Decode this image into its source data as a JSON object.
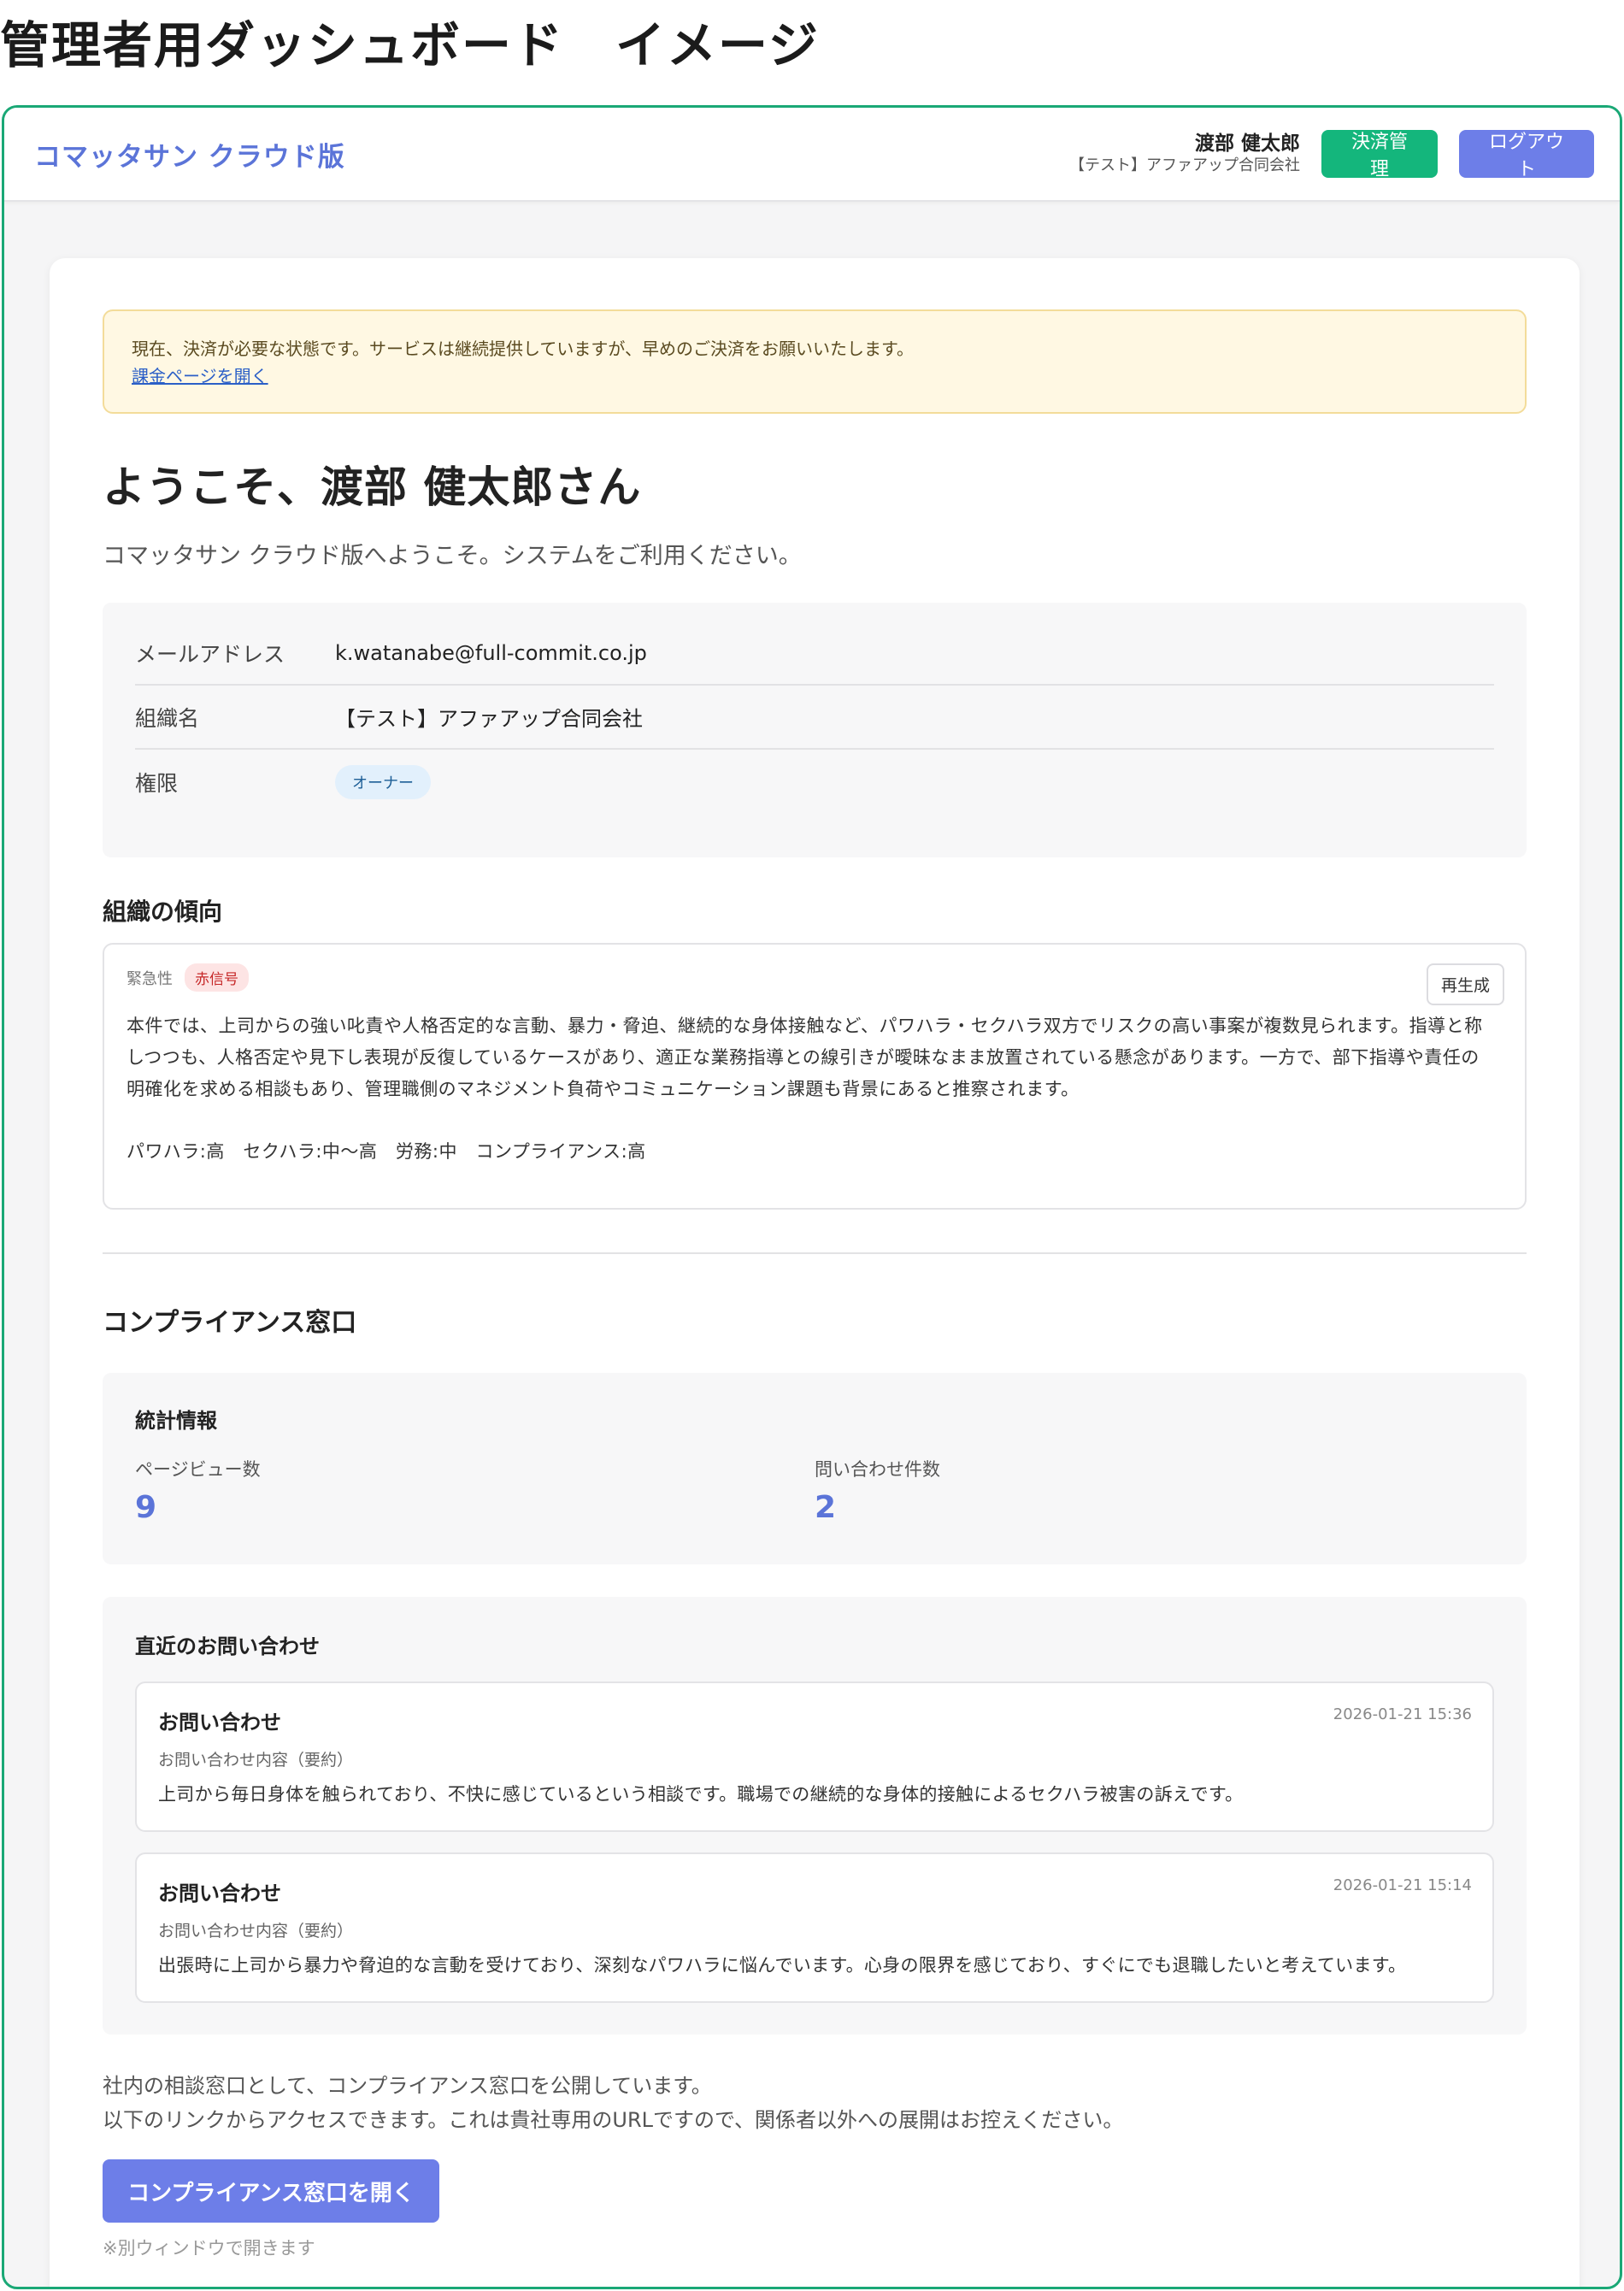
{
  "page": {
    "caption": "管理者用ダッシュボード　イメージ"
  },
  "header": {
    "brand": "コマッタサン クラウド版",
    "user_name": "渡部 健太郎",
    "user_org": "【テスト】アファアップ合同会社",
    "billing_button": "決済管理",
    "logout_button": "ログアウト"
  },
  "notice": {
    "message": "現在、決済が必要な状態です。サービスは継続提供していますが、早めのご決済をお願いいたします。",
    "link": "課金ページを開く"
  },
  "welcome": {
    "title": "ようこそ、渡部 健太郎さん",
    "subtitle": "コマッタサン クラウド版へようこそ。システムをご利用ください。"
  },
  "info": {
    "email_label": "メールアドレス",
    "email_value": "k.watanabe@full-commit.co.jp",
    "org_label": "組織名",
    "org_value": "【テスト】アファアップ合同会社",
    "role_label": "権限",
    "role_value": "オーナー"
  },
  "trend": {
    "title": "組織の傾向",
    "urgency_label": "緊急性",
    "urgency_value": "赤信号",
    "regenerate": "再生成",
    "text_line1": "本件では、上司からの強い叱責や人格否定的な言動、暴力・脅迫、継続的な身体接触など、パワハラ・セクハラ双方でリスクの高い事案が複数見られます。指導と称",
    "text_line2": "しつつも、人格否定や見下し表現が反復しているケースがあり、適正な業務指導との線引きが曖昧なまま放置されている懸念があります。一方で、部下指導や責任の",
    "text_line3": "明確化を求める相談もあり、管理職側のマネジメント負荷やコミュニケーション課題も背景にあると推察されます。",
    "scores": "パワハラ:高　セクハラ:中〜高　労務:中　コンプライアンス:高"
  },
  "compliance": {
    "title": "コンプライアンス窓口",
    "stats_heading": "統計情報",
    "pageviews_label": "ページビュー数",
    "pageviews_value": "9",
    "inquiries_label": "問い合わせ件数",
    "inquiries_value": "2",
    "recent_heading": "直近のお問い合わせ",
    "inquiries": [
      {
        "title": "お問い合わせ",
        "date": "2026-01-21 15:36",
        "summary_label": "お問い合わせ内容（要約）",
        "summary": "上司から毎日身体を触られており、不快に感じているという相談です。職場での継続的な身体的接触によるセクハラ被害の訴えです。"
      },
      {
        "title": "お問い合わせ",
        "date": "2026-01-21 15:14",
        "summary_label": "お問い合わせ内容（要約）",
        "summary": "出張時に上司から暴力や脅迫的な言動を受けており、深刻なパワハラに悩んでいます。心身の限界を感じており、すぐにでも退職したいと考えています。"
      }
    ],
    "footer_line1": "社内の相談窓口として、コンプライアンス窓口を公開しています。",
    "footer_line2": "以下のリンクからアクセスできます。これは貴社専用のURLですので、関係者以外への展開はお控えください。",
    "open_button": "コンプライアンス窓口を開く",
    "open_note": "※別ウィンドウで開きます"
  },
  "colors": {
    "frame_border": "#1aa876",
    "brand": "#5b74d8",
    "billing_button": "#14b67c",
    "primary_button": "#6d7ee8",
    "notice_bg": "#fff8e3",
    "urgency_badge": "#c62828"
  }
}
